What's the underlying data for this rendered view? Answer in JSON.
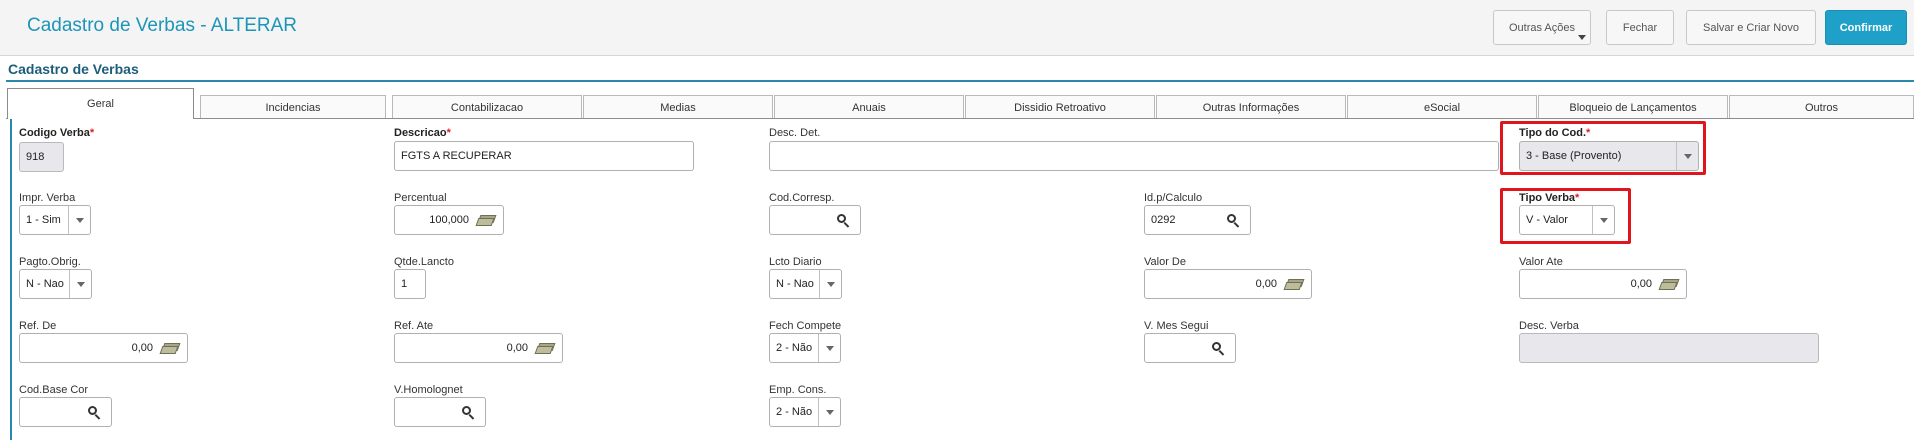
{
  "header": {
    "title": "Cadastro de Verbas - ALTERAR",
    "buttons": {
      "outras_acoes": "Outras Ações",
      "fechar": "Fechar",
      "salvar_criar": "Salvar e Criar Novo",
      "confirmar": "Confirmar"
    }
  },
  "section": {
    "title": "Cadastro de Verbas"
  },
  "tabs": [
    "Geral",
    "Incidencias",
    "Contabilizacao",
    "Medias",
    "Anuais",
    "Dissidio Retroativo",
    "Outras Informações",
    "eSocial",
    "Bloqueio de Lançamentos",
    "Outros"
  ],
  "active_tab": "Geral",
  "required_mark": "*",
  "fields": {
    "codigo_verba": {
      "label": "Codigo Verba",
      "value": "918",
      "required": true
    },
    "descricao": {
      "label": "Descricao",
      "value": "FGTS A RECUPERAR",
      "required": true
    },
    "desc_det": {
      "label": "Desc. Det.",
      "value": ""
    },
    "tipo_cod": {
      "label": "Tipo do Cod.",
      "value": "3 - Base (Provento)",
      "required": true
    },
    "impr_verba": {
      "label": "Impr. Verba",
      "value": "1 - Sim"
    },
    "percentual": {
      "label": "Percentual",
      "value": "100,000"
    },
    "cod_corresp": {
      "label": "Cod.Corresp.",
      "value": ""
    },
    "id_calculo": {
      "label": "Id.p/Calculo",
      "value": "0292"
    },
    "tipo_verba": {
      "label": "Tipo Verba",
      "value": "V - Valor",
      "required": true
    },
    "pagto_obrig": {
      "label": "Pagto.Obrig.",
      "value": "N - Nao"
    },
    "qtde_lancto": {
      "label": "Qtde.Lancto",
      "value": "1"
    },
    "lcto_diario": {
      "label": "Lcto Diario",
      "value": "N - Nao"
    },
    "valor_de": {
      "label": "Valor De",
      "value": "0,00"
    },
    "valor_ate": {
      "label": "Valor Ate",
      "value": "0,00"
    },
    "ref_de": {
      "label": "Ref. De",
      "value": "0,00"
    },
    "ref_ate": {
      "label": "Ref. Ate",
      "value": "0,00"
    },
    "fech_compete": {
      "label": "Fech Compete",
      "value": "2 - Não"
    },
    "v_mes_segui": {
      "label": "V. Mes Segui",
      "value": ""
    },
    "desc_verba": {
      "label": "Desc. Verba",
      "value": ""
    },
    "cod_base_cor": {
      "label": "Cod.Base Cor",
      "value": ""
    },
    "v_homolognet": {
      "label": "V.Homolognet",
      "value": ""
    },
    "emp_cons": {
      "label": "Emp. Cons.",
      "value": "2 - Não"
    }
  },
  "highlight_color": "#e0141c",
  "accent_color": "#1ea0c8"
}
